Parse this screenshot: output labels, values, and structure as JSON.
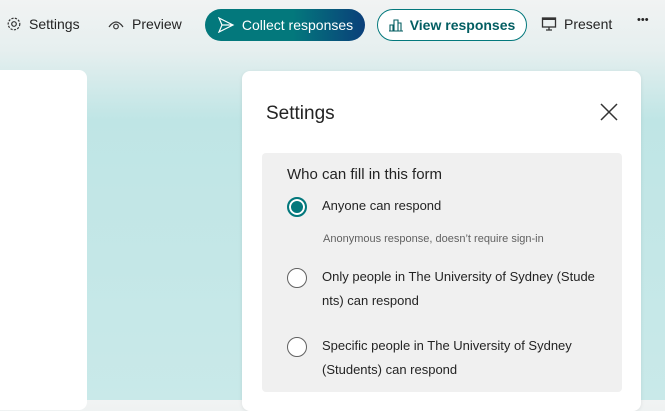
{
  "toolbar": {
    "settings": "Settings",
    "preview": "Preview",
    "collect": "Collect responses",
    "view": "View responses",
    "present": "Present",
    "more": "•••"
  },
  "panel": {
    "title": "Settings",
    "question": "Who can fill in this form",
    "options": [
      {
        "label": "Anyone can respond",
        "selected": true,
        "sub": "Anonymous response, doesn’t require sign-in"
      },
      {
        "label": "Only people in The University of Sydney (Students) can respond",
        "selected": false
      },
      {
        "label": "Specific people in The University of Sydney (Students) can respond",
        "selected": false
      }
    ]
  },
  "colors": {
    "accent": "#03787c"
  }
}
